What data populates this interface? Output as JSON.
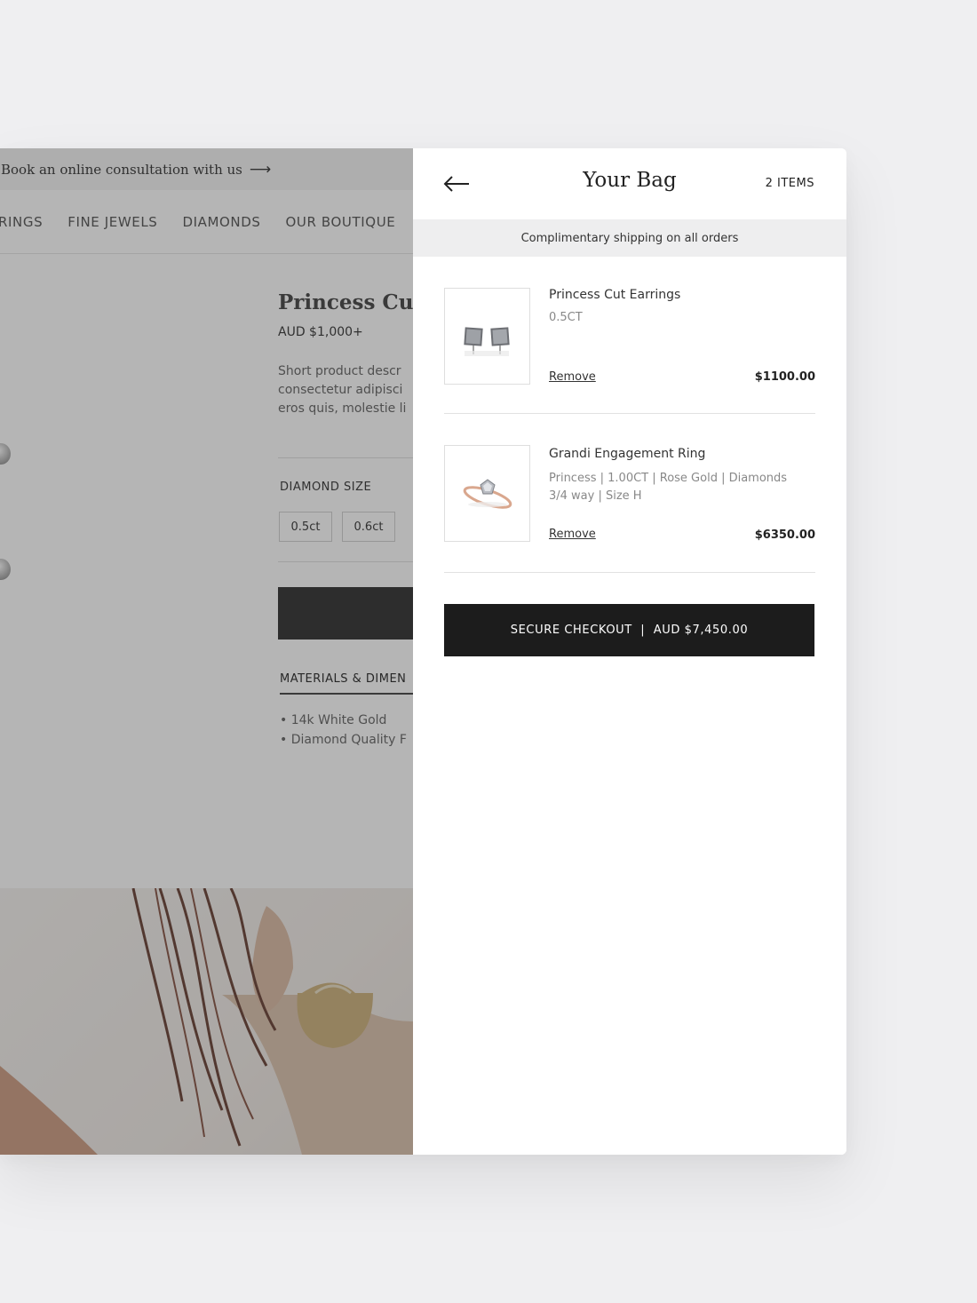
{
  "page": {
    "promo_text": "Book an online consultation with us",
    "promo_arrow": "⟶",
    "nav": [
      "RINGS",
      "FINE JEWELS",
      "DIAMONDS",
      "OUR BOUTIQUE"
    ],
    "product_title": "Princess Cut Ea",
    "product_price": "AUD $1,000+",
    "product_desc": "Short product descr\nconsectetur adipisci\neros quis, molestie li",
    "diamond_size_label": "DIAMOND SIZE",
    "size_options": [
      "0.5ct",
      "0.6ct"
    ],
    "materials_tab": "MATERIALS & DIMEN",
    "materials": [
      "• 14k White Gold",
      "• Diamond Quality F"
    ]
  },
  "bag": {
    "back_icon": "arrow-left-icon",
    "title": "Your Bag",
    "count": "2 ITEMS",
    "shipping": "Complimentary shipping on all orders",
    "items": [
      {
        "name": "Princess Cut Earrings",
        "options": "0.5CT",
        "remove": "Remove",
        "price": "$1100.00"
      },
      {
        "name": "Grandi Engagement Ring",
        "options": "Princess | 1.00CT | Rose Gold | Diamonds\n3/4 way | Size H",
        "remove": "Remove",
        "price": "$6350.00"
      }
    ],
    "checkout": "SECURE CHECKOUT  |  AUD $7,450.00"
  },
  "colors": {
    "background": "#efeff1",
    "overlay": "rgba(70,70,70,0.40)",
    "shipping_bar": "#eeeeef",
    "checkout_button": "#1c1c1c"
  }
}
